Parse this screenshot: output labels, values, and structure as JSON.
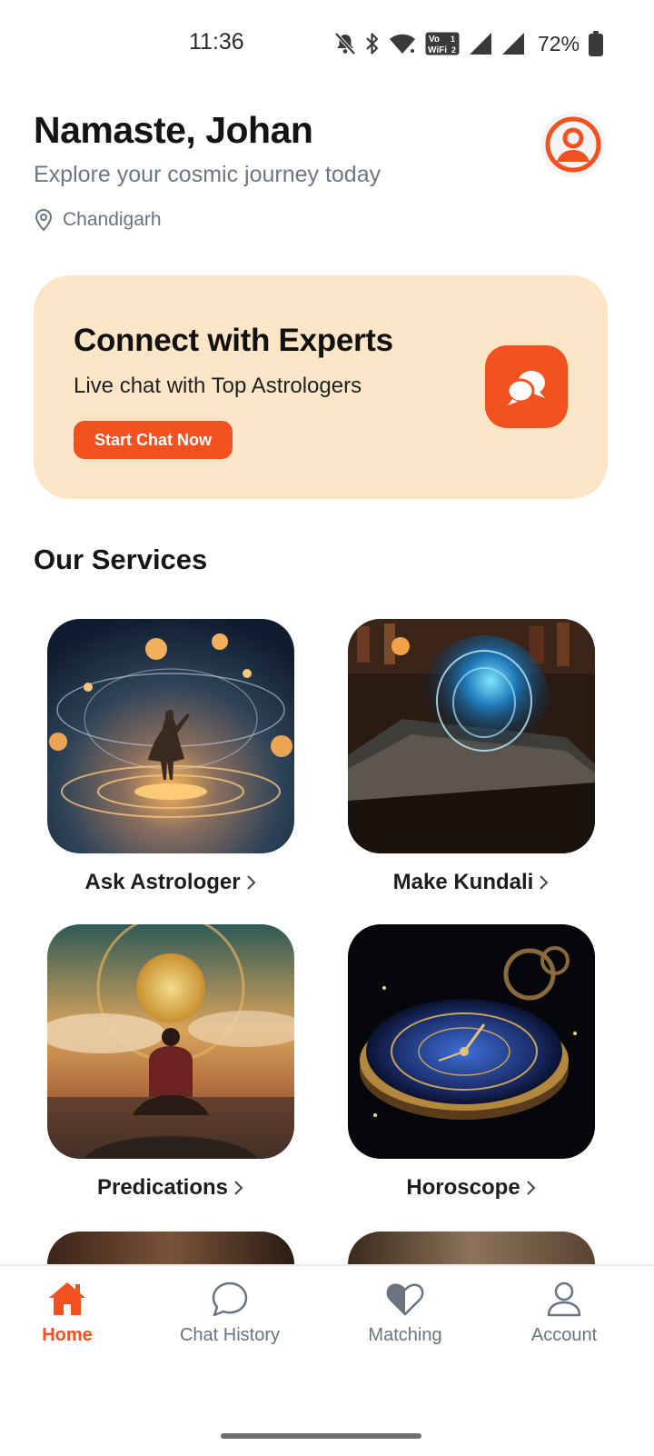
{
  "status_bar": {
    "time": "11:36",
    "battery": "72%",
    "icons": [
      "bell-off-icon",
      "bluetooth-icon",
      "wifi-icon",
      "vowifi-icon",
      "signal-icon",
      "signal-icon",
      "battery-icon"
    ],
    "vowifi_top": "Vo",
    "vowifi_bottom": "WiFi",
    "vowifi_top_index": "1",
    "vowifi_bottom_index": "2"
  },
  "header": {
    "greeting": "Namaste, Johan",
    "subtitle": "Explore your cosmic journey today",
    "location": "Chandigarh",
    "location_icon": "map-pin-icon",
    "avatar_icon": "user-icon"
  },
  "promo": {
    "title": "Connect with Experts",
    "subtitle": "Live chat with Top Astrologers",
    "button_label": "Start Chat Now",
    "icon": "chat-bubbles-icon"
  },
  "services": {
    "title": "Our Services",
    "items": [
      {
        "label": "Ask Astrologer",
        "icon": "chevron-right-icon"
      },
      {
        "label": "Make Kundali",
        "icon": "chevron-right-icon"
      },
      {
        "label": "Predications",
        "icon": "chevron-right-icon"
      },
      {
        "label": "Horoscope",
        "icon": "chevron-right-icon"
      }
    ]
  },
  "nav": {
    "items": [
      {
        "label": "Home",
        "icon": "home-icon",
        "active": true
      },
      {
        "label": "Chat History",
        "icon": "chat-icon",
        "active": false
      },
      {
        "label": "Matching",
        "icon": "heart-icon",
        "active": false
      },
      {
        "label": "Account",
        "icon": "user-icon",
        "active": false
      }
    ]
  },
  "colors": {
    "accent": "#f3511f",
    "promo_bg": "#fde6c7",
    "muted_text": "#6b7280"
  }
}
